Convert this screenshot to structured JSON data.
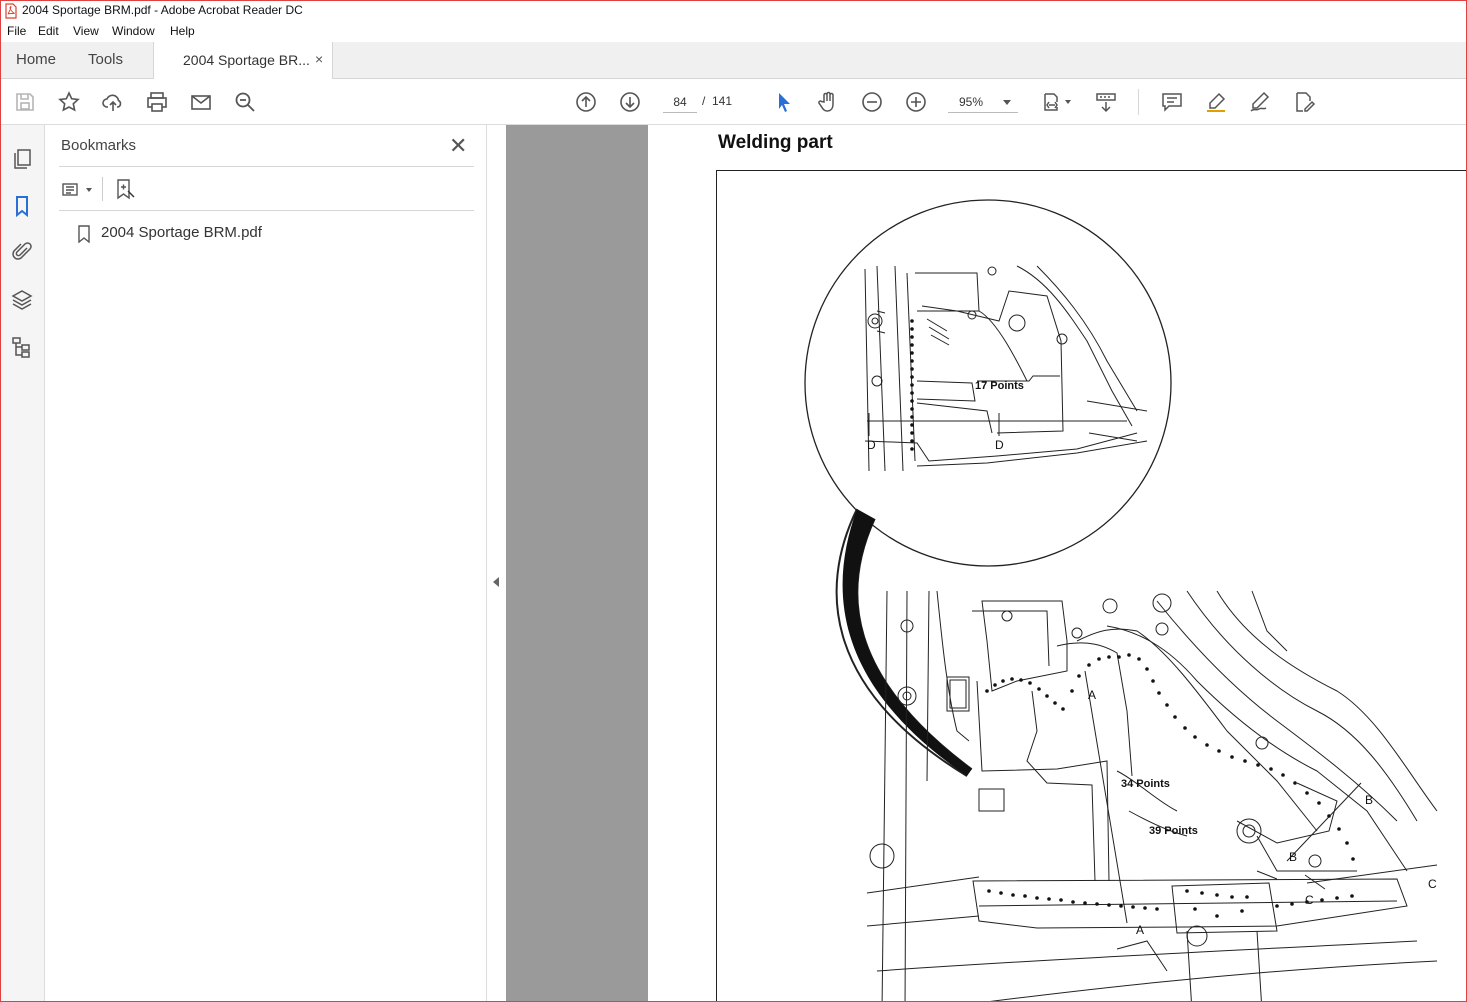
{
  "window": {
    "title": "2004 Sportage BRM.pdf - Adobe Acrobat Reader DC"
  },
  "menu": {
    "file": "File",
    "edit": "Edit",
    "view": "View",
    "window": "Window",
    "help": "Help"
  },
  "tabs": {
    "home": "Home",
    "tools": "Tools",
    "document": "2004 Sportage BR...",
    "close": "×"
  },
  "toolbar": {
    "page_current": "84",
    "page_sep": "/",
    "page_total": "141",
    "zoom": "95%"
  },
  "icons": {
    "save": "save-icon",
    "star": "star-icon",
    "upload": "upload-icon",
    "print": "print-icon",
    "mail": "mail-icon",
    "search": "search-icon",
    "prev": "page-up-icon",
    "next": "page-down-icon",
    "select": "cursor-icon",
    "hand": "hand-icon",
    "zoom_out": "zoom-out-icon",
    "zoom_in": "zoom-in-icon",
    "fit": "fit-page-icon",
    "scroll": "scroll-mode-icon",
    "comment": "comment-icon",
    "highlight": "highlight-icon",
    "sign": "sign-icon",
    "edit": "edit-pdf-icon"
  },
  "colors": {
    "accent_blue": "#2a6fd6",
    "viewer_gray": "#9a9a9a",
    "pdf_red": "#e0402a"
  },
  "bookmarks_panel": {
    "title": "Bookmarks",
    "close": "✕",
    "items": [
      {
        "label": "2004 Sportage BRM.pdf"
      }
    ]
  },
  "document": {
    "heading": "Welding part",
    "callouts": {
      "points_17": "17 Points",
      "points_34": "34 Points",
      "points_39": "39 Points",
      "letter_a": "A",
      "letter_b": "B",
      "letter_c": "C",
      "letter_d": "D"
    }
  }
}
